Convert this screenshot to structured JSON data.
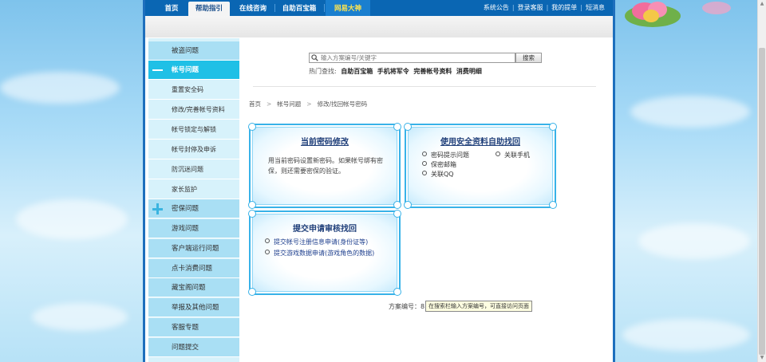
{
  "nav": {
    "tabs": [
      {
        "label": "首页",
        "state": "normal"
      },
      {
        "label": "帮助指引",
        "state": "active"
      },
      {
        "label": "在线咨询",
        "state": "normal"
      },
      {
        "label": "自助百宝箱",
        "state": "normal"
      },
      {
        "label": "网易大神",
        "state": "highlight"
      }
    ],
    "links": [
      "系统公告",
      "登录客服",
      "我的提单",
      "短消息"
    ]
  },
  "sidebar": {
    "items": [
      {
        "label": "被盗问题",
        "kind": "category"
      },
      {
        "label": "帐号问题",
        "kind": "category-open"
      },
      {
        "label": "重置安全码",
        "kind": "sub"
      },
      {
        "label": "修改/完善帐号资料",
        "kind": "sub"
      },
      {
        "label": "帐号锁定与解锁",
        "kind": "sub"
      },
      {
        "label": "帐号封停及申诉",
        "kind": "sub"
      },
      {
        "label": "防沉迷问题",
        "kind": "sub"
      },
      {
        "label": "家长监护",
        "kind": "sub"
      },
      {
        "label": "密保问题",
        "kind": "category-plus"
      },
      {
        "label": "游戏问题",
        "kind": "category"
      },
      {
        "label": "客户端运行问题",
        "kind": "category"
      },
      {
        "label": "点卡消费问题",
        "kind": "category"
      },
      {
        "label": "藏宝阁问题",
        "kind": "category"
      },
      {
        "label": "举报及其他问题",
        "kind": "category"
      },
      {
        "label": "客服专题",
        "kind": "category"
      },
      {
        "label": "问题提交",
        "kind": "category"
      }
    ]
  },
  "search": {
    "placeholder": "输入方案编号/关键字",
    "button_label": "搜索",
    "hot_label": "热门查找:",
    "hot_links": [
      "自助百宝箱",
      "手机将军令",
      "完善帐号资料",
      "消费明细"
    ]
  },
  "breadcrumb": [
    "首页",
    "帐号问题",
    "修改/找回帐号密码"
  ],
  "cards": {
    "current": {
      "title": "当前密码修改",
      "desc": "用当前密码设置新密码。如果帐号绑有密保，则还需要密保的验证。"
    },
    "security": {
      "title": "使用安全资料自助找回",
      "items_left": [
        "密码提示问题",
        "保密邮箱",
        "关联QQ"
      ],
      "items_right": [
        "关联手机"
      ]
    },
    "appeal": {
      "title": "提交申请审核找回",
      "items": [
        "提交帐号注册信息申请(身份证等)",
        "提交游戏数据申请(游戏角色的数据)"
      ]
    }
  },
  "footer": {
    "case_label": "方案编号：8",
    "tooltip": "在搜索栏输入方案编号，可直接访问页面"
  }
}
